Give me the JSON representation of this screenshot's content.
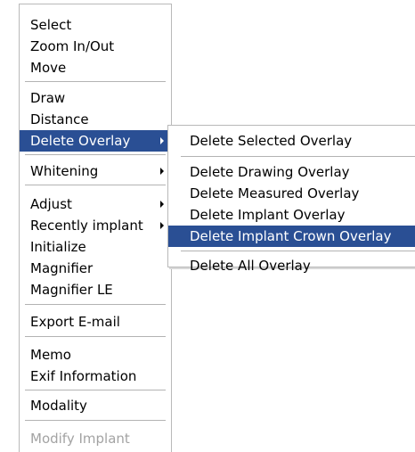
{
  "main_menu": {
    "items": [
      {
        "label": "Select"
      },
      {
        "label": "Zoom In/Out"
      },
      {
        "label": "Move"
      },
      {
        "label": "Draw"
      },
      {
        "label": "Distance"
      },
      {
        "label": "Delete Overlay",
        "highlighted": true,
        "submenu": true
      },
      {
        "label": "Whitening",
        "submenu": true
      },
      {
        "label": "Adjust",
        "submenu": true
      },
      {
        "label": "Recently implant",
        "submenu": true
      },
      {
        "label": "Initialize"
      },
      {
        "label": "Magnifier"
      },
      {
        "label": "Magnifier LE"
      },
      {
        "label": "Export E-mail"
      },
      {
        "label": "Memo"
      },
      {
        "label": "Exif Information"
      },
      {
        "label": "Modality"
      },
      {
        "label": "Modify Implant",
        "disabled": true
      }
    ]
  },
  "sub_menu": {
    "items": [
      {
        "label": "Delete Selected Overlay"
      },
      {
        "label": "Delete Drawing Overlay"
      },
      {
        "label": "Delete Measured Overlay"
      },
      {
        "label": "Delete Implant Overlay"
      },
      {
        "label": "Delete Implant Crown Overlay",
        "highlighted": true
      },
      {
        "label": "Delete All Overlay"
      }
    ]
  },
  "colors": {
    "highlight": "#2a4f94",
    "highlight_text": "#ffffff",
    "disabled_text": "#a3a3a3",
    "separator": "#b3b3b3"
  }
}
